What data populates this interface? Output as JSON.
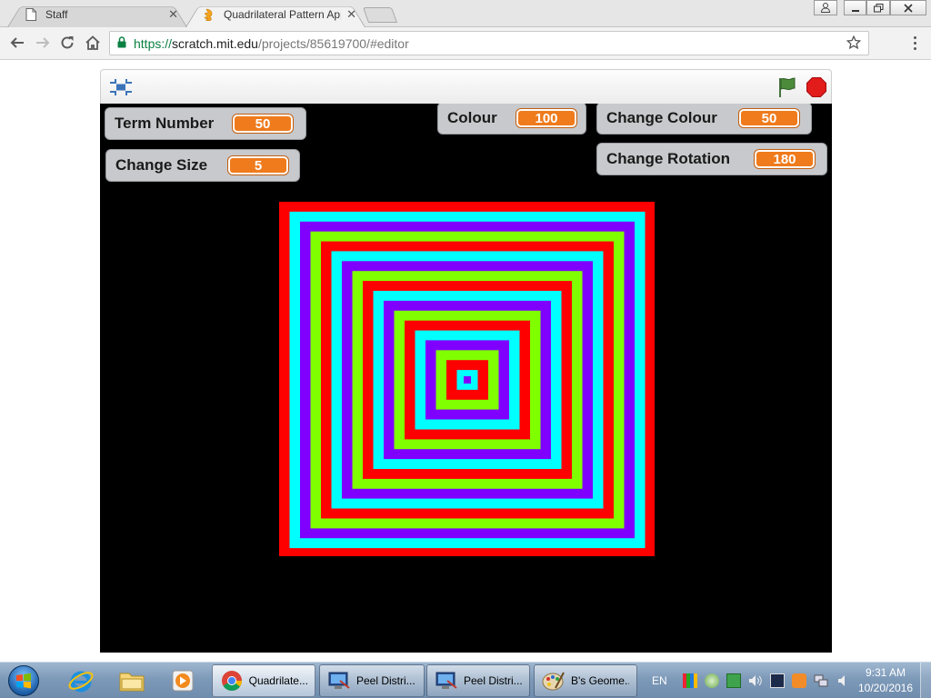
{
  "browser": {
    "tabs": [
      {
        "title": "Staff"
      },
      {
        "title": "Quadrilateral Pattern App",
        "active": true
      }
    ],
    "url": {
      "scheme": "https://",
      "host": "scratch.mit.edu",
      "path": "/projects/85619700/#editor"
    }
  },
  "monitors": {
    "term_number": {
      "label": "Term Number",
      "value": "50"
    },
    "change_size": {
      "label": "Change Size",
      "value": "5"
    },
    "colour": {
      "label": "Colour",
      "value": "100"
    },
    "change_colour": {
      "label": "Change Colour",
      "value": "50"
    },
    "change_rotation": {
      "label": "Change Rotation",
      "value": "180"
    }
  },
  "pattern": {
    "colors": [
      "#ff0000",
      "#00ffff",
      "#8000ff",
      "#80ff00"
    ]
  },
  "taskbar": {
    "tasks": [
      {
        "label": "Quadrilate..."
      },
      {
        "label": "Peel Distri..."
      },
      {
        "label": "Peel Distri..."
      },
      {
        "label": "B's Geome..."
      }
    ],
    "language": "EN",
    "time": "9:31 AM",
    "date": "10/20/2016"
  }
}
